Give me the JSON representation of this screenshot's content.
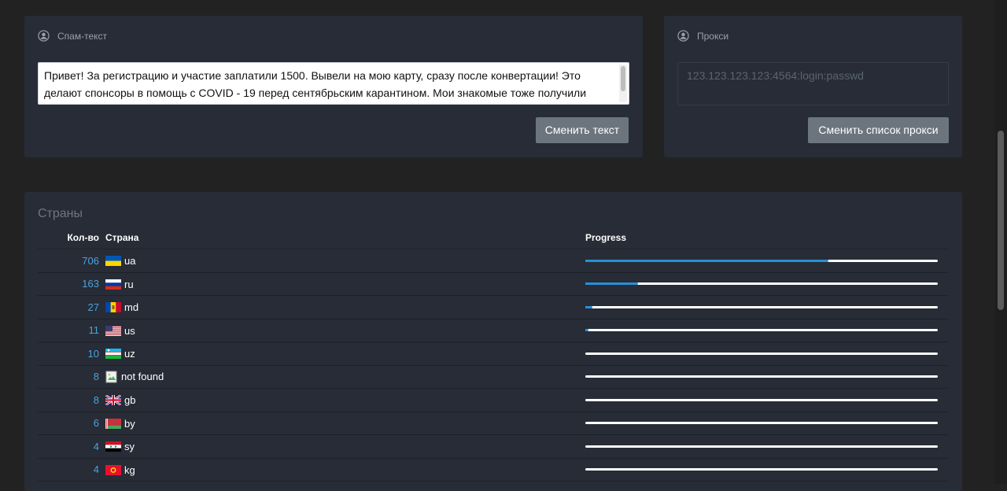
{
  "spam": {
    "title": "Спам-текст",
    "text": "Привет! За регистрацию и участие заплатили 1500. Вывели на мою карту, сразу после конвертации! Это делают спонсоры в помощь с COVID - 19 перед сентябрьским карантином. Мои знакомые тоже получили деньги! Подробности по ссылке в профиле! Спешите, пока акция действует!",
    "button": "Сменить текст"
  },
  "proxy": {
    "title": "Прокси",
    "placeholder": "123.123.123.123:4564:login:passwd",
    "button": "Сменить список прокси"
  },
  "countries": {
    "title": "Страны",
    "headers": {
      "count": "Кол-во",
      "country": "Страна",
      "progress": "Progress"
    },
    "rows": [
      {
        "count": "706",
        "code": "ua",
        "flag": "ua",
        "progress": 0.69
      },
      {
        "count": "163",
        "code": "ru",
        "flag": "ru",
        "progress": 0.15
      },
      {
        "count": "27",
        "code": "md",
        "flag": "md",
        "progress": 0.02
      },
      {
        "count": "11",
        "code": "us",
        "flag": "us",
        "progress": 0.01
      },
      {
        "count": "10",
        "code": "uz",
        "flag": "uz",
        "progress": 0.0
      },
      {
        "count": "8",
        "code": "not found",
        "flag": "broken-image",
        "progress": 0.0
      },
      {
        "count": "8",
        "code": "gb",
        "flag": "gb",
        "progress": 0.0
      },
      {
        "count": "6",
        "code": "by",
        "flag": "by",
        "progress": 0.0
      },
      {
        "count": "4",
        "code": "sy",
        "flag": "sy",
        "progress": 0.0
      },
      {
        "count": "4",
        "code": "kg",
        "flag": "kg",
        "progress": 0.0
      }
    ]
  },
  "colors": {
    "background": "#222222",
    "card": "#272c36",
    "accent": "#2590d8",
    "button": "#6c757d"
  },
  "icons": [
    "user-circle-icon"
  ]
}
